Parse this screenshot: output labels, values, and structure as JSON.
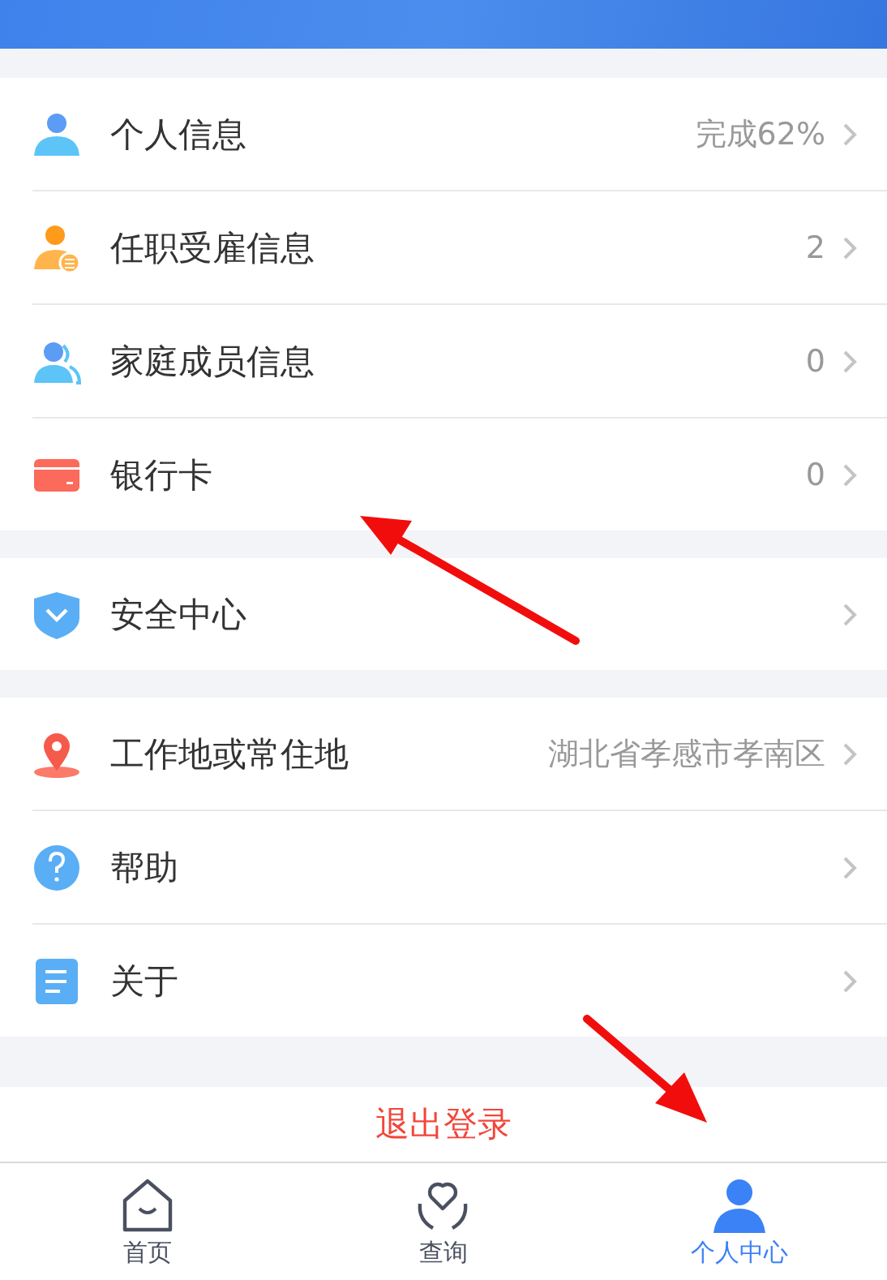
{
  "sections": [
    {
      "items": [
        {
          "label": "个人信息",
          "value": "完成62%"
        },
        {
          "label": "任职受雇信息",
          "value": "2"
        },
        {
          "label": "家庭成员信息",
          "value": "0"
        },
        {
          "label": "银行卡",
          "value": "0"
        }
      ]
    },
    {
      "items": [
        {
          "label": "安全中心"
        }
      ]
    },
    {
      "items": [
        {
          "label": "工作地或常住地",
          "value": "湖北省孝感市孝南区"
        },
        {
          "label": "帮助"
        },
        {
          "label": "关于"
        }
      ]
    }
  ],
  "logout": "退出登录",
  "tabs": [
    {
      "label": "首页",
      "selected": false
    },
    {
      "label": "查询",
      "selected": false
    },
    {
      "label": "个人中心",
      "selected": true
    }
  ]
}
